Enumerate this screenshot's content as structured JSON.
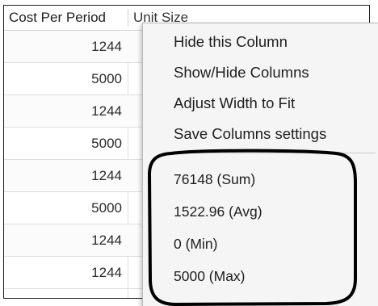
{
  "grid": {
    "columns": [
      "Cost Per Period",
      "Unit Size"
    ],
    "cost_values": [
      "1244",
      "5000",
      "1244",
      "5000",
      "1244",
      "5000",
      "1244",
      "1244"
    ]
  },
  "menu": {
    "items": [
      "Hide this Column",
      "Show/Hide Columns",
      "Adjust Width to Fit",
      "Save Columns settings"
    ],
    "stats": [
      "76148 (Sum)",
      "1522.96 (Avg)",
      "0 (Min)",
      "5000 (Max)"
    ]
  },
  "colors": {
    "annotation_outline": "#000000",
    "menu_background": "#f5f5f5"
  }
}
